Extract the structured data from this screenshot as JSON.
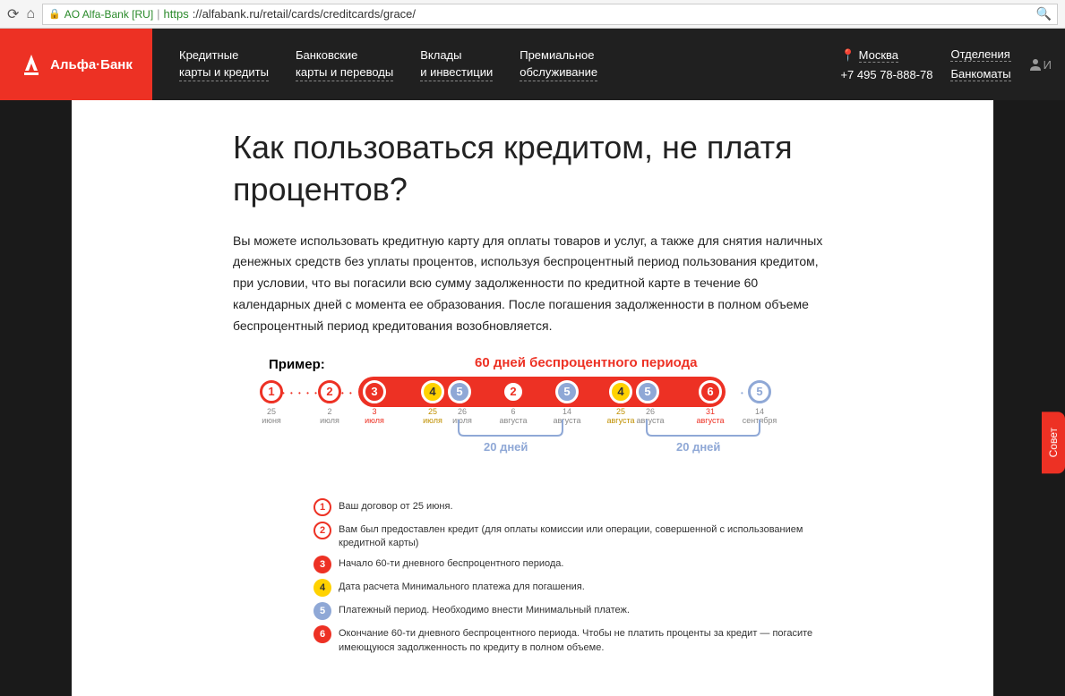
{
  "browser": {
    "org": "AO Alfa-Bank [RU]",
    "proto": "https",
    "url": "://alfabank.ru/retail/cards/creditcards/grace/"
  },
  "logo_text": "Альфа·Банк",
  "nav": [
    "Кредитные\nкарты и кредиты",
    "Банковские\nкарты и переводы",
    "Вклады\nи инвестиции",
    "Премиальное\nобслуживание"
  ],
  "header_right": {
    "city": "Москва",
    "phone": "+7 495 78-888-78",
    "links": [
      "Отделения",
      "Банкоматы"
    ],
    "user_initial": "И"
  },
  "title": "Как пользоваться кредитом, не платя процентов?",
  "intro": "Вы можете использовать кредитную карту для оплаты товаров и услуг, а также для снятия наличных денежных средств без уплаты процентов, используя беспроцентный период пользования кредитом, при условии, что вы погасили всю сумму задолженности по кредитной карте в течение 60 календарных дней с момента ее образования. После погашения задолженности в полном объеме беспроцентный период кредитования возобновляется.",
  "diagram": {
    "example_label": "Пример:",
    "title_60": "60 дней беспроцентного периода",
    "bracket_20": "20 дней",
    "nodes": [
      {
        "n": "1",
        "day": "25",
        "month": "июня"
      },
      {
        "n": "2",
        "day": "2",
        "month": "июля"
      },
      {
        "n": "3",
        "day": "3",
        "month": "июля"
      },
      {
        "n": "4",
        "day": "25",
        "month": "июля"
      },
      {
        "n": "5",
        "day": "26",
        "month": "июля"
      },
      {
        "n": "2",
        "day": "6",
        "month": "августа"
      },
      {
        "n": "5",
        "day": "14",
        "month": "августа"
      },
      {
        "n": "4",
        "day": "25",
        "month": "августа"
      },
      {
        "n": "5",
        "day": "26",
        "month": "августа"
      },
      {
        "n": "6",
        "day": "31",
        "month": "августа"
      },
      {
        "n": "5",
        "day": "14",
        "month": "сентября"
      }
    ]
  },
  "legend": [
    {
      "n": "1",
      "style": "red-o",
      "text": "Ваш договор от 25 июня."
    },
    {
      "n": "2",
      "style": "red-o",
      "text": "Вам был предоставлен кредит (для оплаты комиссии или операции, совершенной с использованием кредитной карты)"
    },
    {
      "n": "3",
      "style": "red-f",
      "text": "Начало 60-ти дневного беспроцентного периода."
    },
    {
      "n": "4",
      "style": "yellow",
      "text": "Дата расчета Минимального платежа для погашения."
    },
    {
      "n": "5",
      "style": "blue",
      "text": "Платежный период. Необходимо внести Минимальный платеж."
    },
    {
      "n": "6",
      "style": "red-f",
      "text": "Окончание 60-ти дневного беспроцентного периода. Чтобы не платить проценты за кредит — погасите имеющуюся задолженность по кредиту в полном объеме."
    }
  ],
  "advice_tab": "Совет"
}
